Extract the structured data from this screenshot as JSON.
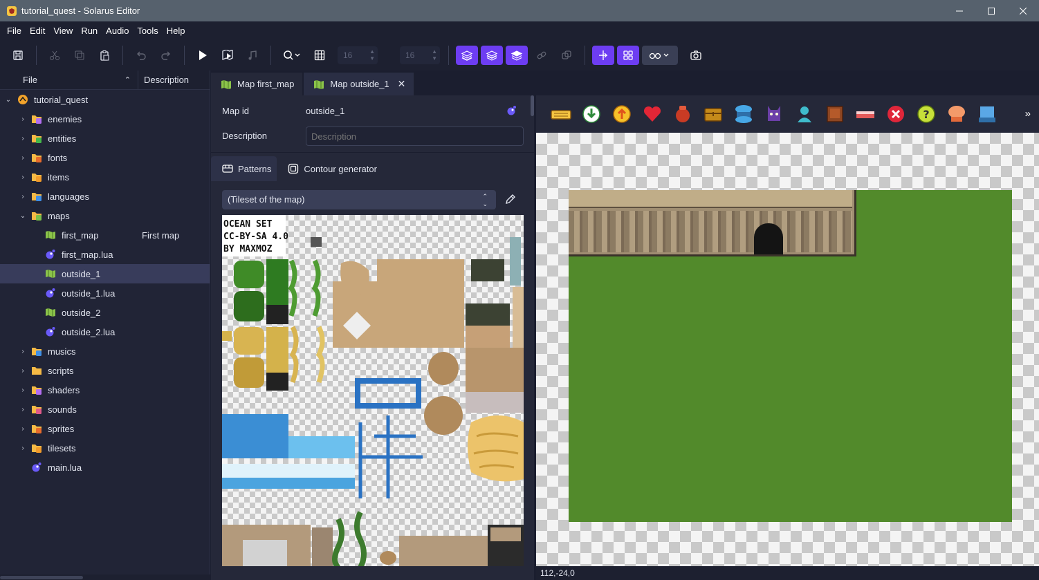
{
  "window": {
    "title": "tutorial_quest - Solarus Editor"
  },
  "menubar": {
    "items": [
      "File",
      "Edit",
      "View",
      "Run",
      "Audio",
      "Tools",
      "Help"
    ]
  },
  "toolbar": {
    "grid_w": "16",
    "grid_h": "16"
  },
  "file_tree": {
    "columns": {
      "file": "File",
      "description": "Description"
    },
    "root": "tutorial_quest",
    "items": [
      {
        "label": "enemies",
        "desc": ""
      },
      {
        "label": "entities",
        "desc": ""
      },
      {
        "label": "fonts",
        "desc": ""
      },
      {
        "label": "items",
        "desc": ""
      },
      {
        "label": "languages",
        "desc": ""
      },
      {
        "label": "maps",
        "desc": ""
      },
      {
        "label": "first_map",
        "desc": "First map"
      },
      {
        "label": "first_map.lua",
        "desc": ""
      },
      {
        "label": "outside_1",
        "desc": ""
      },
      {
        "label": "outside_1.lua",
        "desc": ""
      },
      {
        "label": "outside_2",
        "desc": ""
      },
      {
        "label": "outside_2.lua",
        "desc": ""
      },
      {
        "label": "musics",
        "desc": ""
      },
      {
        "label": "scripts",
        "desc": ""
      },
      {
        "label": "shaders",
        "desc": ""
      },
      {
        "label": "sounds",
        "desc": ""
      },
      {
        "label": "sprites",
        "desc": ""
      },
      {
        "label": "tilesets",
        "desc": ""
      },
      {
        "label": "main.lua",
        "desc": ""
      }
    ]
  },
  "tabs": [
    {
      "label": "Map first_map"
    },
    {
      "label": "Map outside_1"
    }
  ],
  "map_props": {
    "map_id_label": "Map id",
    "map_id_value": "outside_1",
    "description_label": "Description",
    "description_placeholder": "Description"
  },
  "subtabs": {
    "patterns": "Patterns",
    "contour": "Contour generator"
  },
  "tileset_select": "(Tileset of the map)",
  "tileset_art_text": [
    "OCEAN SET",
    "CC-BY-SA 4.0",
    "BY MAXMOZ"
  ],
  "status": {
    "coords": "112,-24,0"
  }
}
